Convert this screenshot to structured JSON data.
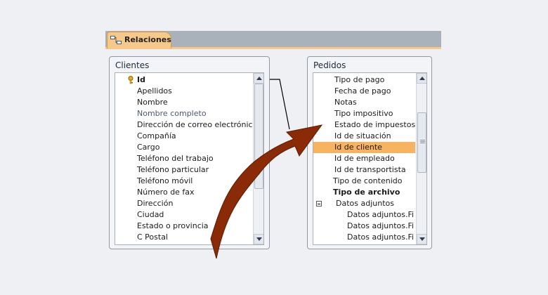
{
  "tab": {
    "label": "Relaciones",
    "icon": "relationships-icon"
  },
  "clientes": {
    "title": "Clientes",
    "primary_key_icon": "key-icon",
    "fields": [
      {
        "label": "Id",
        "bold": true,
        "color": "#1a1a1a"
      },
      {
        "label": "Apellidos",
        "bold": false,
        "color": "#1a1a1a"
      },
      {
        "label": "Nombre",
        "bold": false,
        "color": "#1a1a1a"
      },
      {
        "label": "Nombre completo",
        "bold": false,
        "color": "#4a5a70"
      },
      {
        "label": "Dirección de correo electrónico",
        "bold": false,
        "color": "#1a1a1a"
      },
      {
        "label": "Compañía",
        "bold": false,
        "color": "#1a1a1a"
      },
      {
        "label": "Cargo",
        "bold": false,
        "color": "#1a1a1a"
      },
      {
        "label": "Teléfono del trabajo",
        "bold": false,
        "color": "#1a1a1a"
      },
      {
        "label": "Teléfono particular",
        "bold": false,
        "color": "#1a1a1a"
      },
      {
        "label": "Teléfono móvil",
        "bold": false,
        "color": "#1a1a1a"
      },
      {
        "label": "Número de fax",
        "bold": false,
        "color": "#1a1a1a"
      },
      {
        "label": "Dirección",
        "bold": false,
        "color": "#1a1a1a"
      },
      {
        "label": "Ciudad",
        "bold": false,
        "color": "#1a1a1a"
      },
      {
        "label": "Estado o provincia",
        "bold": false,
        "color": "#1a1a1a"
      },
      {
        "label": "C Postal",
        "bold": false,
        "color": "#1a1a1a"
      }
    ]
  },
  "pedidos": {
    "title": "Pedidos",
    "fields": [
      {
        "label": "Tipo de pago",
        "level": 0
      },
      {
        "label": "Fecha de pago",
        "level": 0
      },
      {
        "label": "Notas",
        "level": 0
      },
      {
        "label": "Tipo impositivo",
        "level": 0
      },
      {
        "label": "Estado de impuestos",
        "level": 0
      },
      {
        "label": "Id de situación",
        "level": 0
      },
      {
        "label": "Id de cliente",
        "level": 0,
        "highlight": true
      },
      {
        "label": "Id de empleado",
        "level": 0
      },
      {
        "label": "Id de transportista",
        "level": 0
      },
      {
        "label": "Tipo de contenido",
        "level": 0,
        "outdent": true
      },
      {
        "label": "Tipo de archivo",
        "level": 0,
        "outdent": true,
        "bold": true
      },
      {
        "label": "Datos adjuntos",
        "level": 0,
        "group": true
      },
      {
        "label": "Datos adjuntos.Fi",
        "level": 1
      },
      {
        "label": "Datos adjuntos.Fi",
        "level": 1
      },
      {
        "label": "Datos adjuntos.Fi",
        "level": 1
      }
    ]
  },
  "colors": {
    "highlight": "#f7b35f",
    "arrow": "#8a2a06",
    "tab": "#f6c98a"
  },
  "relationship": {
    "from_field": "Id",
    "to_field": "Id de cliente"
  }
}
